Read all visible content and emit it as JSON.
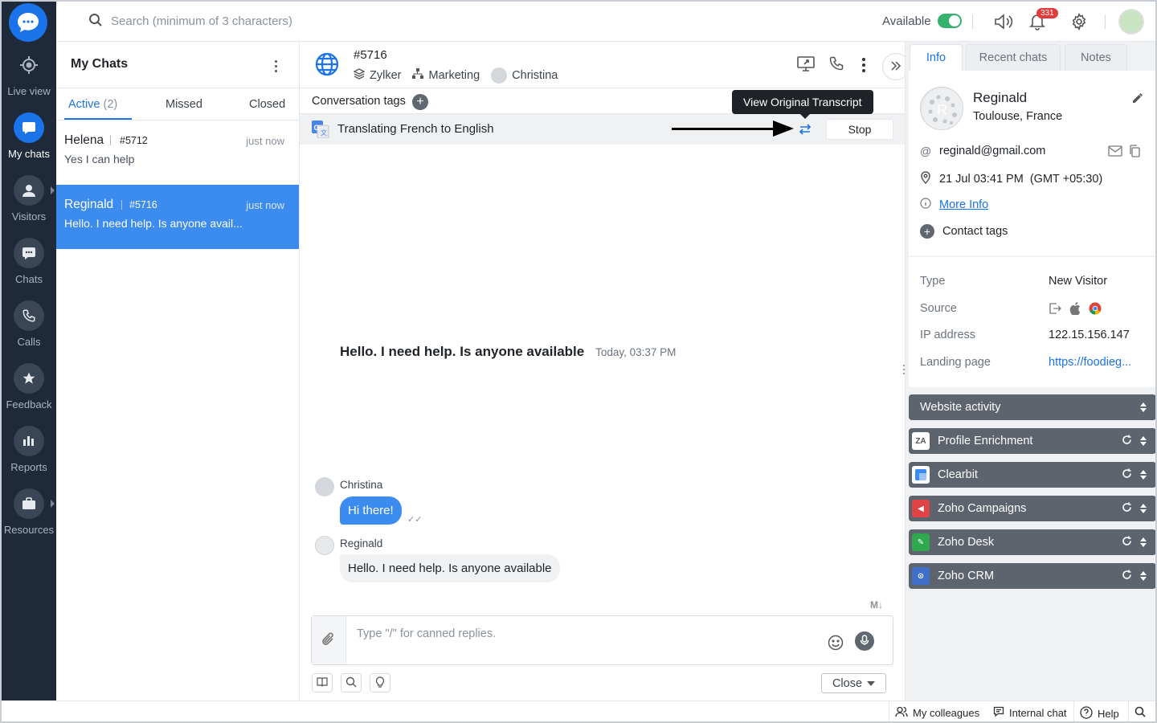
{
  "nav": {
    "items": [
      {
        "label": "Live view",
        "icon": "crosshair-icon"
      },
      {
        "label": "My chats",
        "icon": "chat-bubble-icon"
      },
      {
        "label": "Visitors",
        "icon": "person-icon"
      },
      {
        "label": "Chats",
        "icon": "chat-dots-icon"
      },
      {
        "label": "Calls",
        "icon": "phone-icon"
      },
      {
        "label": "Feedback",
        "icon": "star-icon"
      },
      {
        "label": "Reports",
        "icon": "bar-chart-icon"
      },
      {
        "label": "Resources",
        "icon": "briefcase-icon"
      }
    ]
  },
  "topbar": {
    "search_placeholder": "Search (minimum of 3 characters)",
    "status_label": "Available",
    "notification_count": "331"
  },
  "chatlist": {
    "title": "My Chats",
    "tabs": {
      "active_label": "Active",
      "active_count": "(2)",
      "missed_label": "Missed",
      "closed_label": "Closed"
    },
    "items": [
      {
        "name": "Helena",
        "id": "#5712",
        "time": "just now",
        "preview": "Yes I can help"
      },
      {
        "name": "Reginald",
        "id": "#5716",
        "time": "just now",
        "preview": "Hello. I need help. Is anyone avail..."
      }
    ]
  },
  "chat": {
    "title": "#5716",
    "brand": "Zylker",
    "department": "Marketing",
    "agent": "Christina",
    "tags_label": "Conversation tags",
    "tooltip": "View Original Transcript",
    "translating_text": "Translating French to English",
    "stop_label": "Stop",
    "system_message": "Hello. I need help. Is anyone available",
    "system_time": "Today, 03:37 PM",
    "messages": [
      {
        "sender": "Christina",
        "text": "Hi there!"
      },
      {
        "sender": "Reginald",
        "text": "Hello. I need help. Is anyone available"
      }
    ],
    "markdown_badge": "M↓",
    "composer_placeholder": "Type \"/\" for canned replies.",
    "close_label": "Close"
  },
  "info": {
    "tabs": {
      "info": "Info",
      "recent": "Recent chats",
      "notes": "Notes"
    },
    "visitor_name": "Reginald",
    "location": "Toulouse, France",
    "email": "reginald@gmail.com",
    "datetime": "21 Jul 03:41 PM  (GMT +05:30)",
    "more_info": "More Info",
    "contact_tags": "Contact tags",
    "details": [
      {
        "key": "Type",
        "value": "New Visitor"
      },
      {
        "key": "Source",
        "value": ""
      },
      {
        "key": "IP address",
        "value": "122.15.156.147"
      },
      {
        "key": "Landing page",
        "value": "https://foodieg..."
      }
    ],
    "widgets": [
      {
        "label": "Website activity"
      },
      {
        "label": "Profile Enrichment"
      },
      {
        "label": "Clearbit"
      },
      {
        "label": "Zoho Campaigns"
      },
      {
        "label": "Zoho Desk"
      },
      {
        "label": "Zoho CRM"
      }
    ]
  },
  "bottombar": {
    "colleagues": "My colleagues",
    "internal_chat": "Internal chat",
    "help": "Help"
  },
  "colors": {
    "nav_bg": "#1e2a3a",
    "accent": "#1a73e8",
    "selected_row": "#3c8cf0",
    "available_green": "#35b26d",
    "widget_bg": "#5d646d"
  }
}
